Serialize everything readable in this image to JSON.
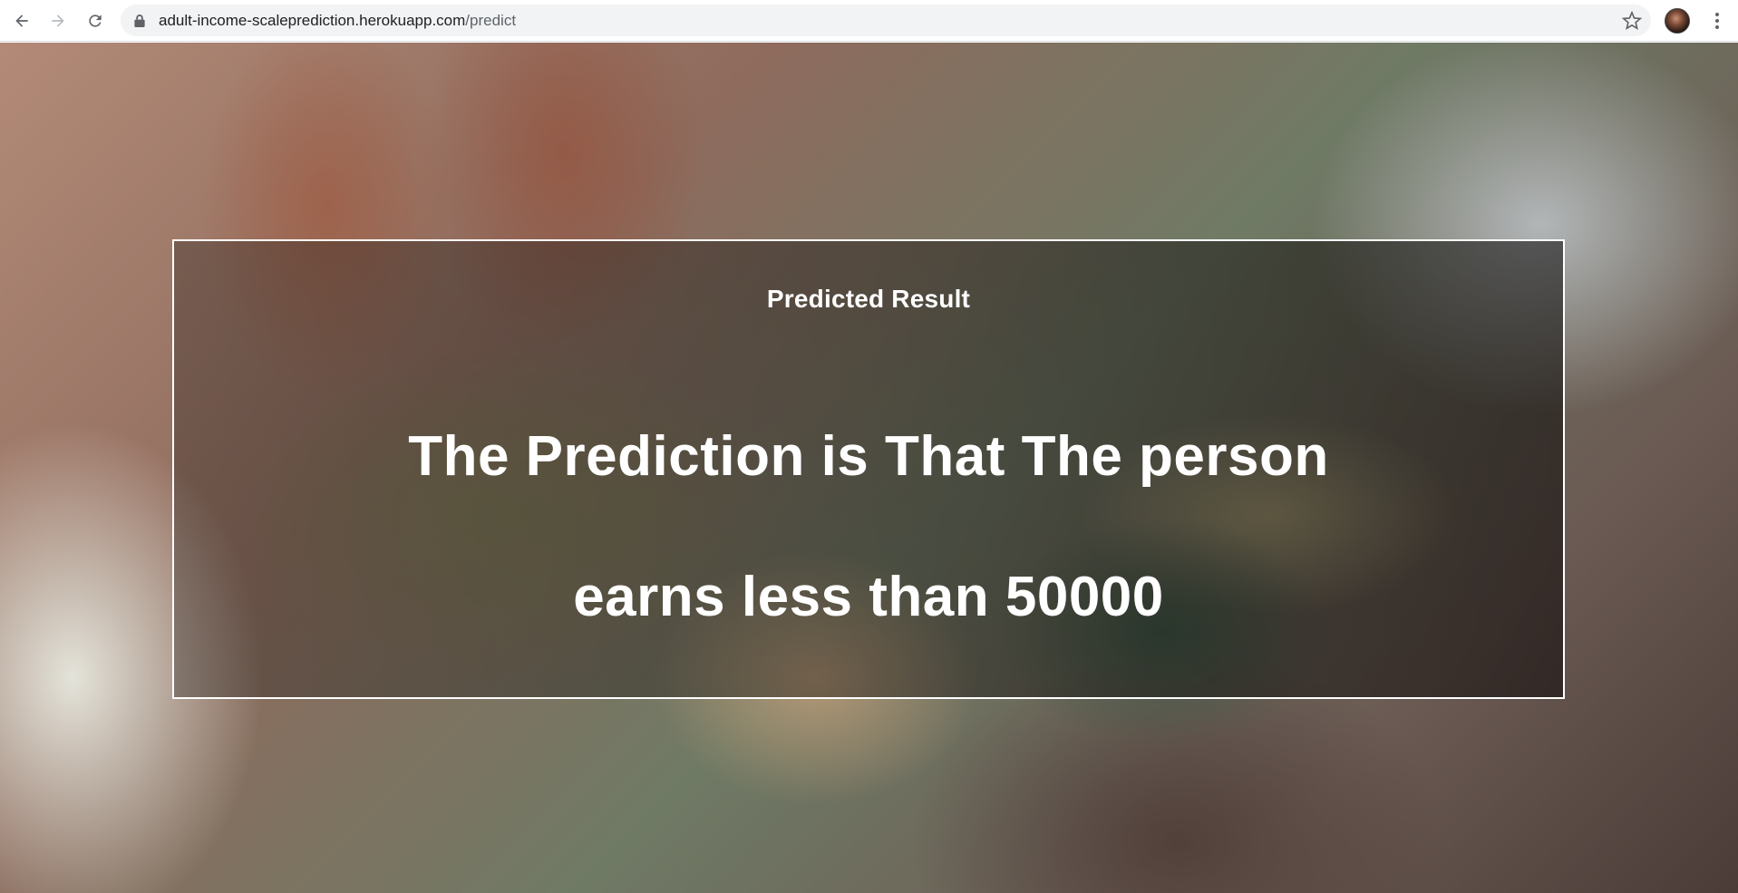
{
  "browser": {
    "url_host": "adult-income-scaleprediction.herokuapp.com",
    "url_path": "/predict",
    "icons": {
      "back": "arrow-left-icon",
      "forward": "arrow-right-icon",
      "reload": "reload-icon",
      "lock": "lock-icon",
      "bookmark": "star-icon",
      "menu": "kebab-menu-icon"
    }
  },
  "page": {
    "title": "Predicted Result",
    "prediction_text": "The Prediction is That The person earns less than 50000"
  }
}
